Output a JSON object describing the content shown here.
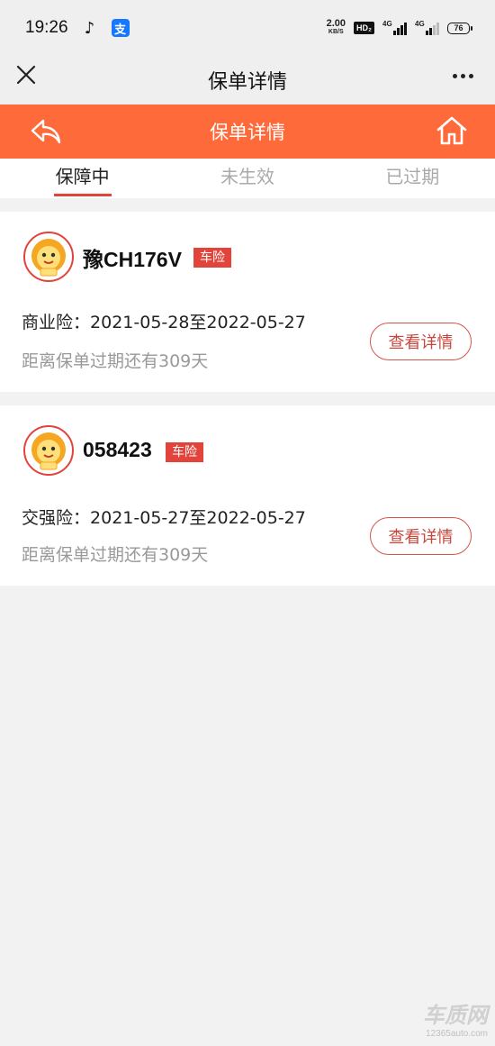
{
  "status_bar": {
    "time": "19:26",
    "net_speed_value": "2.00",
    "net_speed_unit": "KB/S",
    "hd_label": "HD₂",
    "signal1_label": "4G",
    "signal2_label": "4G",
    "battery": "76"
  },
  "nav": {
    "title": "保单详情"
  },
  "header": {
    "title": "保单详情",
    "color": "#ff6a3a"
  },
  "tabs": [
    {
      "label": "保障中",
      "active": true
    },
    {
      "label": "未生效",
      "active": false
    },
    {
      "label": "已过期",
      "active": false
    }
  ],
  "policies": [
    {
      "plate": "豫CH176V",
      "badge": "车险",
      "coverage_label": "商业险：",
      "coverage_period": "2021-05-28至2022-05-27",
      "remaining": "距离保单过期还有309天",
      "button": "查看详情"
    },
    {
      "plate": "058423",
      "badge": "车险",
      "coverage_label": "交强险：",
      "coverage_period": "2021-05-27至2022-05-27",
      "remaining": "距离保单过期还有309天",
      "button": "查看详情"
    }
  ],
  "watermark": {
    "main": "车质网",
    "url": "12365auto.com"
  },
  "colors": {
    "accent_red": "#e2443b",
    "orange": "#ff6a3a"
  }
}
